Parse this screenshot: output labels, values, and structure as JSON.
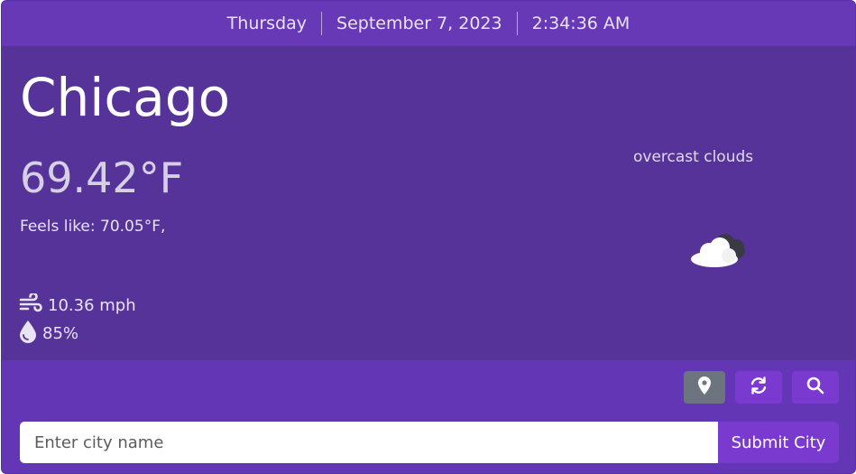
{
  "header": {
    "day": "Thursday",
    "date": "September 7, 2023",
    "time": "2:34:36 AM"
  },
  "weather": {
    "city": "Chicago",
    "temperature": "69.42°F",
    "feels_like": "Feels like: 70.05°F,",
    "description": "overcast clouds",
    "icon": "overcast-clouds-icon",
    "wind": "10.36 mph",
    "humidity": "85%"
  },
  "actions": {
    "location_icon": "map-pin-icon",
    "refresh_icon": "refresh-icon",
    "search_icon": "search-icon"
  },
  "search": {
    "placeholder": "Enter city name",
    "value": "",
    "submit_label": "Submit City"
  },
  "colors": {
    "header_bg": "#6739b7",
    "panel_bg": "#553399",
    "accent_button": "#7a3ad0",
    "location_button": "#6c757d"
  }
}
